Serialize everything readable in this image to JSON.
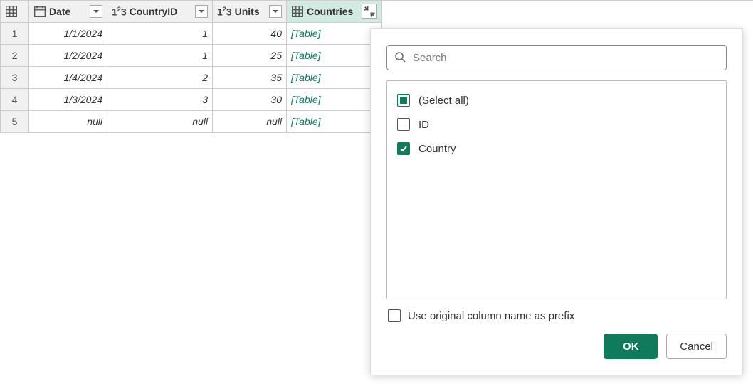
{
  "columns": {
    "date": "Date",
    "countryId": "CountryID",
    "units": "Units",
    "countries": "Countries"
  },
  "rows": [
    {
      "n": "1",
      "date": "1/1/2024",
      "countryId": "1",
      "units": "40",
      "countries": "[Table]"
    },
    {
      "n": "2",
      "date": "1/2/2024",
      "countryId": "1",
      "units": "25",
      "countries": "[Table]"
    },
    {
      "n": "3",
      "date": "1/4/2024",
      "countryId": "2",
      "units": "35",
      "countries": "[Table]"
    },
    {
      "n": "4",
      "date": "1/3/2024",
      "countryId": "3",
      "units": "30",
      "countries": "[Table]"
    },
    {
      "n": "5",
      "date": "null",
      "countryId": "null",
      "units": "null",
      "countries": "[Table]"
    }
  ],
  "popup": {
    "searchPlaceholder": "Search",
    "options": {
      "selectAll": "(Select all)",
      "id": "ID",
      "country": "Country"
    },
    "prefixLabel": "Use original column name as prefix",
    "ok": "OK",
    "cancel": "Cancel"
  }
}
